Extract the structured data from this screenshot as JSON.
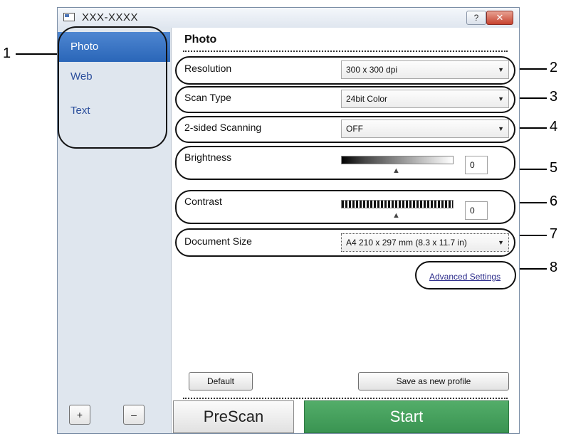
{
  "window": {
    "title": "XXX-XXXX",
    "help_label": "?",
    "close_label": "✕"
  },
  "sidebar": {
    "items": [
      {
        "label": "Photo",
        "active": true
      },
      {
        "label": "Web",
        "active": false
      },
      {
        "label": "Text",
        "active": false
      }
    ],
    "add_label": "+",
    "remove_label": "–"
  },
  "main": {
    "title": "Photo",
    "resolution": {
      "label": "Resolution",
      "value": "300 x 300 dpi"
    },
    "scan_type": {
      "label": "Scan Type",
      "value": "24bit Color"
    },
    "two_sided": {
      "label": "2-sided Scanning",
      "value": "OFF"
    },
    "brightness": {
      "label": "Brightness",
      "value": "0"
    },
    "contrast": {
      "label": "Contrast",
      "value": "0"
    },
    "document_size": {
      "label": "Document Size",
      "value": "A4 210 x 297 mm (8.3 x 11.7 in)"
    },
    "advanced_link": "Advanced Settings",
    "default_label": "Default",
    "save_profile_label": "Save as new profile",
    "prescan_label": "PreScan",
    "start_label": "Start"
  },
  "callouts": [
    "1",
    "2",
    "3",
    "4",
    "5",
    "6",
    "7",
    "8"
  ],
  "colors": {
    "accent": "#2a66b8",
    "start": "#3f9a57",
    "link": "#2a2a8a"
  }
}
